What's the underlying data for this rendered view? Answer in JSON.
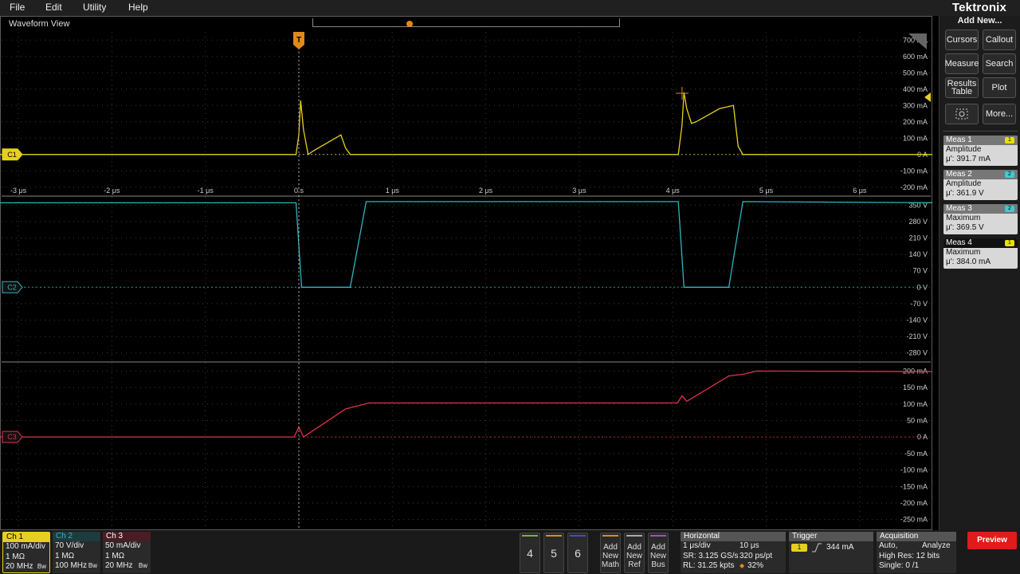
{
  "menu": [
    "File",
    "Edit",
    "Utility",
    "Help"
  ],
  "brand": "Tektronix",
  "side": {
    "add_new": "Add New...",
    "buttons": [
      "Cursors",
      "Callout",
      "Measure",
      "Search",
      "Results Table",
      "Plot",
      "More..."
    ]
  },
  "measurements": [
    {
      "name": "Meas 1",
      "badge": "1",
      "badge_color": "#e8e000",
      "type": "Amplitude",
      "value": "μ': 391.7 mA",
      "highlight": false
    },
    {
      "name": "Meas 2",
      "badge": "2",
      "badge_color": "#3ecad0",
      "type": "Amplitude",
      "value": "μ': 361.9 V",
      "highlight": false
    },
    {
      "name": "Meas 3",
      "badge": "2",
      "badge_color": "#3ecad0",
      "type": "Maximum",
      "value": "μ': 369.5 V",
      "highlight": false
    },
    {
      "name": "Meas 4",
      "badge": "1",
      "badge_color": "#e8e000",
      "type": "Maximum",
      "value": "μ': 384.0 mA",
      "highlight": true
    }
  ],
  "waveform_view": {
    "title": "Waveform View",
    "trigger_marker": "T",
    "time_ticks": [
      "-3 μs",
      "-2 μs",
      "-1 μs",
      "0 s",
      "1 μs",
      "2 μs",
      "3 μs",
      "4 μs",
      "5 μs",
      "6 μs"
    ],
    "colors": {
      "c1": "#e6d01e",
      "c2": "#2fb4be",
      "c3": "#e0324a",
      "grid": "#3a3a3a"
    }
  },
  "chart_data": [
    {
      "type": "line",
      "channel": "C1",
      "unit": "mA",
      "y_ticks": [
        "700 mA",
        "600 mA",
        "500 mA",
        "400 mA",
        "300 mA",
        "200 mA",
        "100 mA",
        "0 A",
        "-100 mA",
        "-200 mA"
      ],
      "x_us": [
        -3.2,
        -0.03,
        0,
        0.02,
        0.05,
        0.1,
        0.15,
        0.3,
        0.45,
        0.5,
        0.55,
        4.06,
        4.1,
        4.12,
        4.15,
        4.2,
        4.25,
        4.5,
        4.65,
        4.7,
        4.75,
        6.9
      ],
      "y": [
        0,
        0,
        120,
        330,
        150,
        0,
        20,
        70,
        120,
        40,
        0,
        0,
        180,
        380,
        280,
        190,
        200,
        280,
        300,
        50,
        0,
        0
      ],
      "ylim": [
        -200,
        700
      ]
    },
    {
      "type": "line",
      "channel": "C2",
      "unit": "V",
      "y_ticks": [
        "350 V",
        "280 V",
        "210 V",
        "140 V",
        "70 V",
        "0 V",
        "-70 V",
        "-140 V",
        "-210 V",
        "-280 V"
      ],
      "x_us": [
        -3.2,
        -0.03,
        0.03,
        0.55,
        0.72,
        4.06,
        4.12,
        4.6,
        4.75,
        6.9
      ],
      "y": [
        360,
        360,
        0,
        0,
        365,
        365,
        0,
        0,
        365,
        360
      ],
      "ylim": [
        -350,
        350
      ]
    },
    {
      "type": "line",
      "channel": "C3",
      "unit": "mA",
      "y_ticks": [
        "200 mA",
        "150 mA",
        "100 mA",
        "50 mA",
        "0 A",
        "-50 mA",
        "-100 mA",
        "-150 mA",
        "-200 mA",
        "-250 mA"
      ],
      "x_us": [
        -3.2,
        -0.05,
        0,
        0.05,
        0.5,
        0.75,
        4.05,
        4.1,
        4.15,
        4.6,
        4.75,
        4.9,
        6.9
      ],
      "y": [
        0,
        0,
        30,
        0,
        85,
        103,
        103,
        125,
        108,
        185,
        190,
        200,
        198
      ],
      "ylim": [
        -250,
        200
      ]
    }
  ],
  "channels": [
    {
      "name": "Ch 1",
      "color": "#e6d01e",
      "lines": [
        "100 mA/div",
        "1 MΩ",
        "20 MHz"
      ]
    },
    {
      "name": "Ch 2",
      "color": "#2fb4be",
      "lines": [
        "70 V/div",
        "1 MΩ",
        "100 MHz"
      ]
    },
    {
      "name": "Ch 3",
      "color": "#e0324a",
      "lines": [
        "50 mA/div",
        "1 MΩ",
        "20 MHz"
      ]
    }
  ],
  "num_buttons": [
    {
      "label": "4",
      "color": "#7bb13a"
    },
    {
      "label": "5",
      "color": "#e08a1a"
    },
    {
      "label": "6",
      "color": "#4a4ac0"
    }
  ],
  "add_buttons": [
    {
      "label": "Add New Math",
      "color": "#e08a1a"
    },
    {
      "label": "Add New Ref",
      "color": "#aaaaaa"
    },
    {
      "label": "Add New Bus",
      "color": "#a050c0"
    }
  ],
  "horizontal": {
    "title": "Horizontal",
    "scale": "1 μs/div",
    "duration": "10 μs",
    "sample_rate": "SR: 3.125 GS/s",
    "pts": "320 ps/pt",
    "record": "RL: 31.25 kpts",
    "position": "32%"
  },
  "trigger": {
    "title": "Trigger",
    "source": "1",
    "level": "344 mA"
  },
  "acquisition": {
    "title": "Acquisition",
    "mode": "Auto,",
    "state": "Analyze",
    "resolution": "High Res: 12 bits",
    "single": "Single: 0 /1"
  },
  "preview": "Preview"
}
